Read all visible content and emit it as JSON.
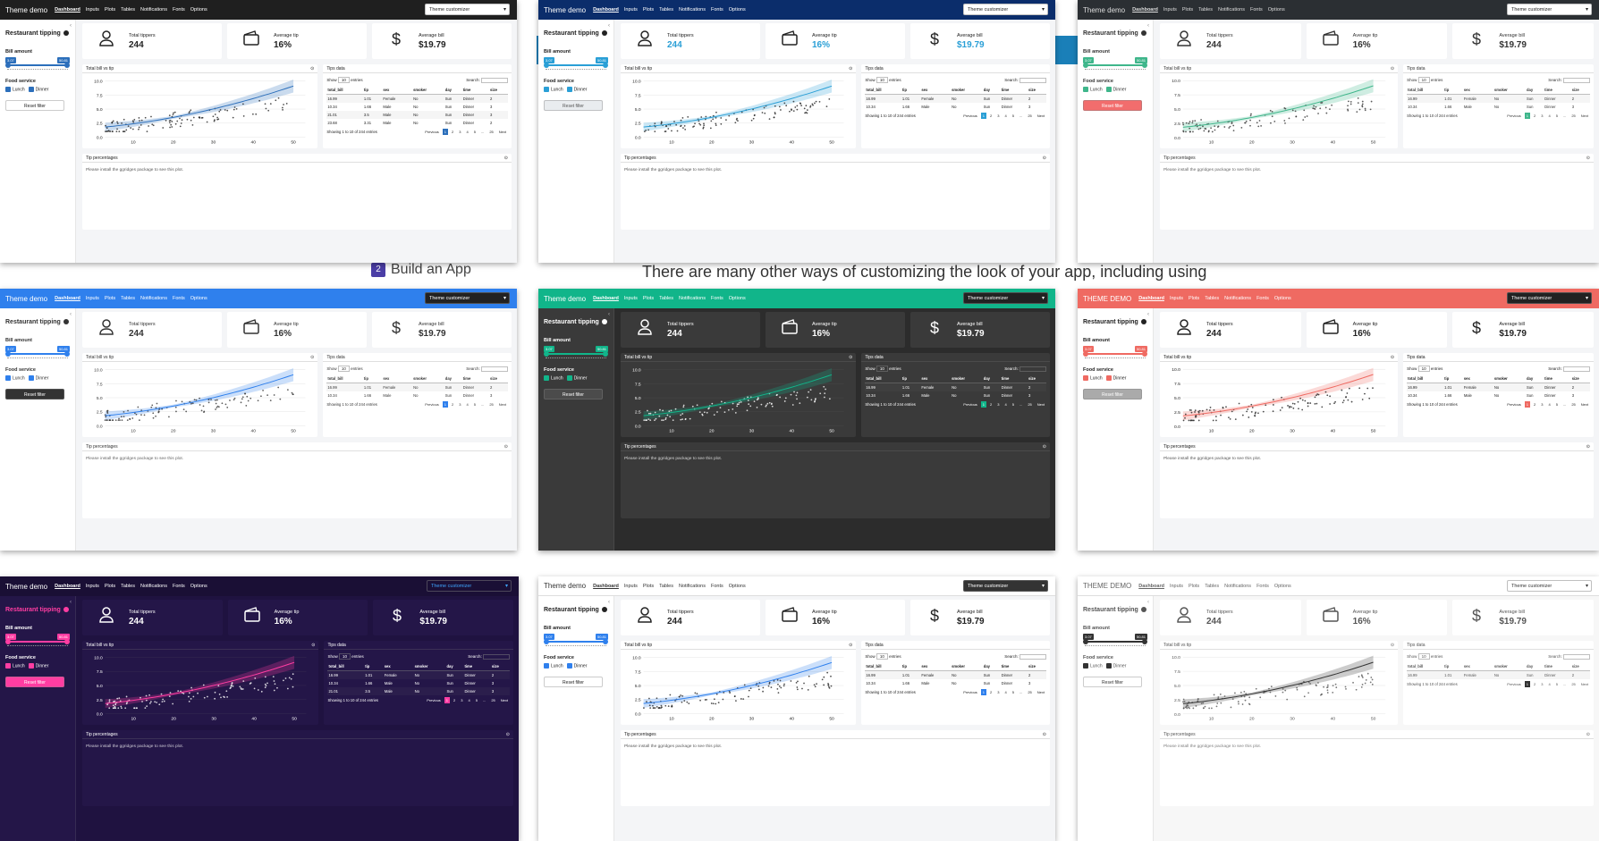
{
  "background": {
    "step_number": "2",
    "step_label": "Build an App",
    "paragraph": "There are many other ways of customizing the look of your app, including using"
  },
  "common": {
    "nav": [
      "Dashboard",
      "Inputs",
      "Plots",
      "Tables",
      "Notifications",
      "Fonts",
      "Options"
    ],
    "sidebar_title": "Restaurant tipping",
    "bill_amount_label": "Bill amount",
    "slider_min": "3.07",
    "slider_max": "50.81",
    "food_service_label": "Food service",
    "lunch_label": "Lunch",
    "dinner_label": "Dinner",
    "reset_label": "Reset filter",
    "total_tippers_label": "Total tippers",
    "total_tippers_value": "244",
    "average_tip_label": "Average tip",
    "average_tip_value": "16%",
    "average_bill_label": "Average bill",
    "average_bill_value": "$19.79",
    "plot_title": "Total bill vs tip",
    "table_title": "Tips data",
    "show_label": "Show",
    "show_value": "10",
    "entries_label": "entries",
    "search_label": "Search:",
    "table_headers": [
      "total_bill",
      "tip",
      "sex",
      "smoker",
      "day",
      "time",
      "size"
    ],
    "table_rows": [
      [
        "16.99",
        "1.01",
        "Female",
        "No",
        "Sun",
        "Dinner",
        "2"
      ],
      [
        "10.34",
        "1.66",
        "Male",
        "No",
        "Sun",
        "Dinner",
        "3"
      ],
      [
        "21.01",
        "3.5",
        "Male",
        "No",
        "Sun",
        "Dinner",
        "3"
      ],
      [
        "23.68",
        "3.31",
        "Male",
        "No",
        "Sun",
        "Dinner",
        "2"
      ]
    ],
    "table_info": "Showing 1 to 10 of 244 entries",
    "table_info_short": "Showing 1 to 10 of 244 entries",
    "pager_prev": "Previous",
    "pager_next": "Next",
    "pager_pages": [
      "1",
      "2",
      "3",
      "4",
      "5",
      "...",
      "25"
    ],
    "tip_pct_title": "Tip percentages",
    "tip_pct_msg": "Please install the ggridges package to see this plot.",
    "y_ticks": [
      "10.0",
      "7.5",
      "5.0",
      "2.5",
      "0.0"
    ],
    "x_ticks": [
      "10",
      "20",
      "30",
      "40",
      "50"
    ]
  },
  "panels": [
    {
      "brand": "Theme demo",
      "theme_select": "Theme customizer",
      "navbar_bg": "#1f1f1f",
      "navbar_fg": "#ffffff",
      "page_bg": "#f4f5f7",
      "card_bg": "#ffffff",
      "text": "#222222",
      "accent": "#2c6fbb",
      "stat_color": "#222222",
      "select_bg": "#ffffff",
      "select_fg": "#222222",
      "reset_bg": "#ffffff",
      "reset_fg": "#222222",
      "rows": 4
    },
    {
      "brand": "Theme demo",
      "theme_select": "Theme customizer",
      "navbar_bg": "#0b2d6b",
      "navbar_fg": "#ffffff",
      "page_bg": "#f4f5f7",
      "card_bg": "#ffffff",
      "text": "#222222",
      "accent": "#2a9fd6",
      "stat_color": "#2a9fd6",
      "select_bg": "#ffffff",
      "select_fg": "#222222",
      "reset_bg": "#e9ecef",
      "reset_fg": "#555555",
      "rows": 2
    },
    {
      "brand": "Theme demo",
      "theme_select": "Theme customizer",
      "navbar_bg": "#2b2f33",
      "navbar_fg": "#dddddd",
      "page_bg": "#f4f5f7",
      "card_bg": "#ffffff",
      "text": "#333333",
      "accent": "#3fb68b",
      "stat_color": "#333333",
      "select_bg": "#ffffff",
      "select_fg": "#222222",
      "reset_bg": "#f26d6d",
      "reset_fg": "#ffffff",
      "rows": 2
    },
    {
      "brand": "Theme demo",
      "theme_select": "Theme customizer",
      "navbar_bg": "#2f80ed",
      "navbar_fg": "#ffffff",
      "page_bg": "#f4f5f7",
      "card_bg": "#ffffff",
      "text": "#333333",
      "accent": "#2f80ed",
      "stat_color": "#333333",
      "select_bg": "#222222",
      "select_fg": "#ffffff",
      "reset_bg": "#333333",
      "reset_fg": "#ffffff",
      "rows": 2
    },
    {
      "brand": "Theme demo",
      "theme_select": "Theme customizer",
      "navbar_bg": "#11b58a",
      "navbar_fg": "#ffffff",
      "page_bg": "#2c2c2c",
      "card_bg": "#3a3a3a",
      "text": "#ffffff",
      "accent": "#11b58a",
      "stat_color": "#ffffff",
      "select_bg": "#222222",
      "select_fg": "#ffffff",
      "reset_bg": "#4b4b4b",
      "reset_fg": "#ffffff",
      "rows": 2
    },
    {
      "brand": "THEME DEMO",
      "theme_select": "Theme customizer",
      "navbar_bg": "#ef6a62",
      "navbar_fg": "#ffffff",
      "page_bg": "#f4f5f7",
      "card_bg": "#ffffff",
      "text": "#222222",
      "accent": "#ef6a62",
      "stat_color": "#222222",
      "select_bg": "#222222",
      "select_fg": "#ffffff",
      "reset_bg": "#aaaaaa",
      "reset_fg": "#ffffff",
      "rows": 2
    },
    {
      "brand": "Theme demo",
      "theme_select": "Theme customizer",
      "navbar_bg": "#1a0f35",
      "navbar_fg": "#ffffff",
      "page_bg": "#1f1240",
      "card_bg": "#241648",
      "text": "#ffffff",
      "accent": "#ff3da2",
      "stat_color": "#ffffff",
      "select_bg": "#1a0f35",
      "select_fg": "#3fa6ff",
      "reset_bg": "#ff3da2",
      "reset_fg": "#ffffff",
      "rows": 3
    },
    {
      "brand": "Theme demo",
      "theme_select": "Theme customizer",
      "navbar_bg": "#ffffff",
      "navbar_fg": "#333333",
      "page_bg": "#f4f5f7",
      "card_bg": "#ffffff",
      "text": "#222222",
      "accent": "#2f80ed",
      "stat_color": "#222222",
      "select_bg": "#333333",
      "select_fg": "#ffffff",
      "reset_bg": "#ffffff",
      "reset_fg": "#222222",
      "rows": 2
    },
    {
      "brand": "THEME DEMO",
      "theme_select": "Theme customizer",
      "navbar_bg": "#ffffff",
      "navbar_fg": "#666666",
      "page_bg": "#f7f7f7",
      "card_bg": "#ffffff",
      "text": "#555555",
      "accent": "#333333",
      "stat_color": "#555555",
      "select_bg": "#ffffff",
      "select_fg": "#333333",
      "reset_bg": "#ffffff",
      "reset_fg": "#333333",
      "rows": 1
    }
  ]
}
